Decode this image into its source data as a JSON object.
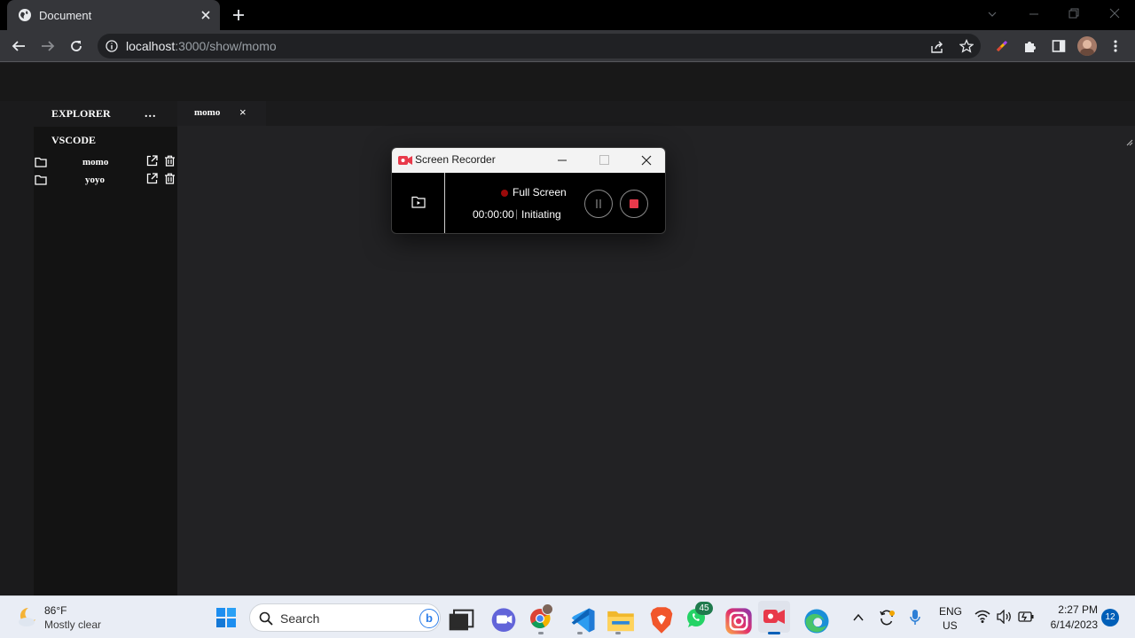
{
  "browser": {
    "tab_title": "Document",
    "url_host": "localhost",
    "url_path": ":3000/show/momo"
  },
  "explorer": {
    "title": "EXPLORER",
    "more": "...",
    "section": "VSCODE",
    "items": [
      {
        "name": "momo"
      },
      {
        "name": "yoyo"
      }
    ]
  },
  "editor": {
    "tab_label": "momo",
    "tab_close": "×"
  },
  "recorder": {
    "title": "Screen Recorder",
    "mode": "Full Screen",
    "time": "00:00:00",
    "separator": "|",
    "status": "Initiating",
    "colors": {
      "record": "#e8394a",
      "indicator": "#9b0a0a"
    }
  },
  "taskbar": {
    "weather_temp": "86°F",
    "weather_desc": "Mostly clear",
    "search_placeholder": "Search",
    "whatsapp_badge": "45",
    "lang_top": "ENG",
    "lang_bottom": "US",
    "time": "2:27 PM",
    "date": "6/14/2023",
    "notif_count": "12"
  }
}
